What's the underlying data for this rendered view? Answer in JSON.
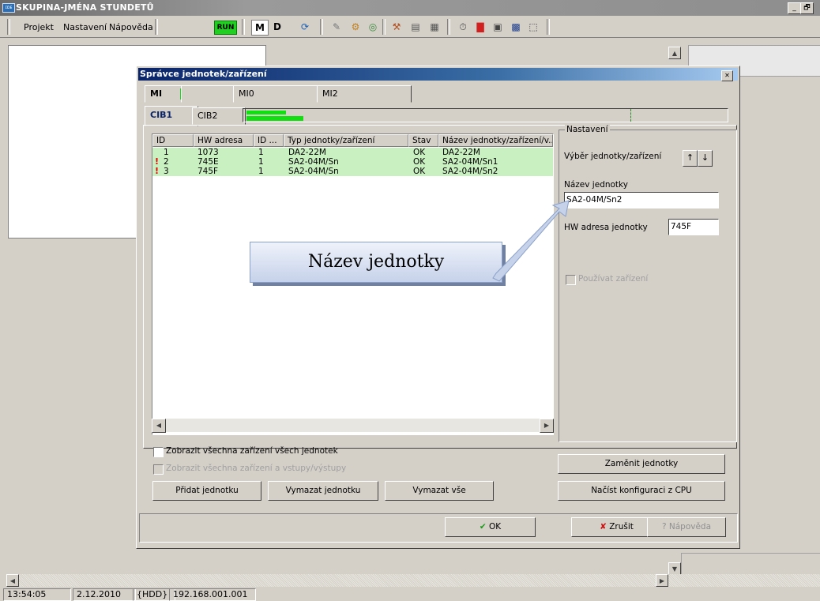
{
  "app": {
    "title": "SKUPINA-JMÉNA STUNDETŮ",
    "icon_label": "ɪᴅᴇ"
  },
  "window_buttons": {
    "minimize": "_",
    "restore": "🗗"
  },
  "menu": {
    "items": [
      "Projekt",
      "Nastavení",
      "Nápověda"
    ]
  },
  "toolbar": {
    "run": "RUN",
    "m": "M",
    "d": "D"
  },
  "dialog": {
    "title": "Správce jednotek/zařízení",
    "tabs_top": [
      "MI",
      "MI0",
      "MI2"
    ],
    "tabs_sub": [
      "CIB1",
      "CIB2"
    ],
    "columns": [
      "ID",
      "HW adresa",
      "ID ...",
      "Typ jednotky/zařízení",
      "Stav",
      "Název jednotky/zařízení/v..."
    ],
    "rows": [
      {
        "id": "1",
        "hw": "1073",
        "id2": "1",
        "type": "DA2-22M",
        "state": "OK",
        "name": "DA2-22M",
        "warn": false
      },
      {
        "id": "2",
        "hw": "745E",
        "id2": "1",
        "type": "SA2-04M/Sn",
        "state": "OK",
        "name": "SA2-04M/Sn1",
        "warn": true
      },
      {
        "id": "3",
        "hw": "745F",
        "id2": "1",
        "type": "SA2-04M/Sn",
        "state": "OK",
        "name": "SA2-04M/Sn2",
        "warn": true
      }
    ],
    "warn_glyph": "!",
    "settings": {
      "legend": "Nastavení",
      "select_label": "Výběr jednotky/zařízení",
      "name_label": "Název jednotky",
      "name_value": "SA2-04M/Sn2",
      "hw_label": "HW adresa jednotky",
      "hw_value": "745F",
      "use_device": "Používat zařízení"
    },
    "checkbox_all_devices": "Zobrazit všechna zařízení všech jednotek",
    "checkbox_all_io": "Zobrazit všechna zařízení a vstupy/výstupy",
    "buttons": {
      "add": "Přidat jednotku",
      "delete": "Vymazat jednotku",
      "delete_all": "Vymazat vše",
      "swap": "Zaměnit jednotky",
      "load": "Načíst konfiguraci z CPU",
      "ok": "OK",
      "cancel": "Zrušit",
      "help": "Nápověda"
    }
  },
  "callout": {
    "text": "Název jednotky"
  },
  "status": {
    "time": "13:54:05",
    "date": "2.12.2010",
    "hdd": "{HDD}",
    "ip": "192.168.001.001"
  }
}
